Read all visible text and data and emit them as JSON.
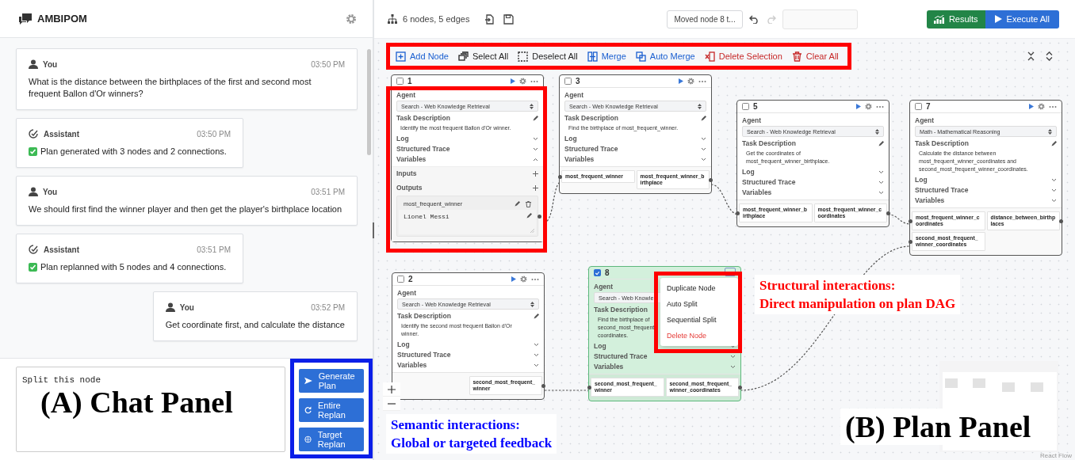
{
  "chat_panel": {
    "title": "AMBIPOM",
    "messages": [
      {
        "kind": "user",
        "sender": "You",
        "time": "03:50 PM",
        "text": "What is the distance between the birthplaces of the first and second most frequent Ballon d'Or winners?"
      },
      {
        "kind": "assistant",
        "sender": "Assistant",
        "time": "03:50 PM",
        "text": "Plan generated with 3 nodes and 2 connections."
      },
      {
        "kind": "user",
        "sender": "You",
        "time": "03:51 PM",
        "text": "We should first find the winner player and then get the player's birthplace location"
      },
      {
        "kind": "assistant",
        "sender": "Assistant",
        "time": "03:51 PM",
        "text": "Plan replanned with 5 nodes and 4 connections."
      },
      {
        "kind": "user",
        "sender": "You",
        "time": "03:52 PM",
        "text": "Get coordinate first, and calculate the distance"
      }
    ],
    "input": {
      "value": "Split this node"
    },
    "buttons": [
      {
        "kind": "send",
        "label": "Generate Plan"
      },
      {
        "kind": "replan",
        "label": "Entire Replan"
      },
      {
        "kind": "target",
        "label": "Target Replan"
      }
    ],
    "annotations": [
      {
        "kind": "panel_label",
        "lines": [
          "(A) Chat Panel"
        ],
        "color": "#000000"
      }
    ]
  },
  "plan_panel": {
    "summary": "6 nodes, 5 edges",
    "history": "Moved node 8 t...",
    "undo": {
      "disabled": false
    },
    "redo": {
      "disabled": true
    },
    "results": "Results",
    "execute": "Execute All",
    "toolbar": [
      {
        "kind": "add",
        "label": "Add Node",
        "color": "#1a5fd0"
      },
      {
        "kind": "select",
        "label": "Select All",
        "color": "#222222"
      },
      {
        "kind": "deselect",
        "label": "Deselect All",
        "color": "#222222"
      },
      {
        "kind": "merge",
        "label": "Merge",
        "color": "#1a5fd0"
      },
      {
        "kind": "auto_merge",
        "label": "Auto Merge",
        "color": "#1a5fd0"
      },
      {
        "kind": "delete",
        "label": "Delete Selection",
        "color": "#c62828"
      },
      {
        "kind": "clear",
        "label": "Clear All",
        "color": "#c62828"
      }
    ],
    "nodes": [
      {
        "id": "1",
        "checked": false,
        "selected": false,
        "menu_open": false,
        "agent_label": "Agent",
        "agent": "Search - Web Knowledge Retrieval",
        "task_label": "Task Description",
        "task_lines": [
          "Identify the most frequent Ballon d'Or winner."
        ],
        "sections": [
          {
            "label": "Log",
            "expanded": false
          },
          {
            "label": "Structured Trace",
            "expanded": false
          },
          {
            "label": "Variables",
            "expanded": true
          }
        ],
        "variables": {
          "inputs_label": "Inputs",
          "outputs_label": "Outputs",
          "outputs": [
            {
              "name": "most_frequent_winner",
              "value": "Lionel Messi"
            }
          ]
        }
      },
      {
        "id": "3",
        "checked": false,
        "selected": false,
        "menu_open": false,
        "agent_label": "Agent",
        "agent": "Search - Web Knowledge Retrieval",
        "task_label": "Task Description",
        "task_lines": [
          "Find the birthplace of most_frequent_winner."
        ],
        "sections": [
          {
            "label": "Log",
            "expanded": false
          },
          {
            "label": "Structured Trace",
            "expanded": false
          },
          {
            "label": "Variables",
            "expanded": false
          }
        ],
        "ports": [
          {
            "name": "most_frequent_winner",
            "kind": "input"
          },
          {
            "name": "most_frequent_winner_birthplace",
            "kind": "output"
          }
        ]
      },
      {
        "id": "5",
        "checked": false,
        "selected": false,
        "menu_open": false,
        "agent_label": "Agent",
        "agent": "Search - Web Knowledge Retrieval",
        "task_label": "Task Description",
        "task_lines": [
          "Get the coordinates of",
          "most_frequent_winner_birthplace."
        ],
        "sections": [
          {
            "label": "Log",
            "expanded": false
          },
          {
            "label": "Structured Trace",
            "expanded": false
          },
          {
            "label": "Variables",
            "expanded": false
          }
        ],
        "ports": [
          {
            "name": "most_frequent_winner_birthplace",
            "kind": "input"
          },
          {
            "name": "most_frequent_winner_coordinates",
            "kind": "output"
          }
        ]
      },
      {
        "id": "7",
        "checked": false,
        "selected": false,
        "menu_open": false,
        "agent_label": "Agent",
        "agent": "Math - Mathematical Reasoning",
        "task_label": "Task Description",
        "task_lines": [
          "Calculate the distance between",
          "most_frequent_winner_coordinates and",
          "second_most_frequent_winner_coordinates."
        ],
        "sections": [
          {
            "label": "Log",
            "expanded": false
          },
          {
            "label": "Structured Trace",
            "expanded": false
          },
          {
            "label": "Variables",
            "expanded": false
          }
        ],
        "ports": [
          {
            "name": "most_frequent_winner_coordinates",
            "kind": "input"
          },
          {
            "name": "distance_between_birthplaces",
            "kind": "output"
          },
          {
            "name": "second_most_frequent_winner_coordinates",
            "kind": "input"
          }
        ]
      },
      {
        "id": "2",
        "checked": false,
        "selected": false,
        "menu_open": false,
        "agent_label": "Agent",
        "agent": "Search - Web Knowledge Retrieval",
        "task_label": "Task Description",
        "task_lines": [
          "Identify the second most frequent Ballon d'Or",
          "winner."
        ],
        "sections": [
          {
            "label": "Log",
            "expanded": false
          },
          {
            "label": "Structured Trace",
            "expanded": false
          },
          {
            "label": "Variables",
            "expanded": false
          }
        ],
        "ports": [
          {
            "name": "second_most_frequent_winner",
            "kind": "output"
          }
        ]
      },
      {
        "id": "8",
        "checked": true,
        "selected": true,
        "menu_open": true,
        "agent_label": "Agent",
        "agent": "Search - Web Knowle",
        "task_label": "Task Description",
        "task_lines": [
          "Find the birthplace of",
          "second_most_frequent",
          "coordinates."
        ],
        "sections": [
          {
            "label": "Log",
            "expanded": false
          },
          {
            "label": "Structured Trace",
            "expanded": false
          },
          {
            "label": "Variables",
            "expanded": false
          }
        ],
        "ports": [
          {
            "name": "second_most_frequent_winner",
            "kind": "input"
          },
          {
            "name": "second_most_frequent_winner_coordinates",
            "kind": "output"
          }
        ]
      }
    ],
    "context_menu": [
      {
        "label": "Duplicate Node",
        "danger": false
      },
      {
        "label": "Auto Split",
        "danger": false
      },
      {
        "label": "Sequential Split",
        "danger": false
      },
      {
        "label": "Delete Node",
        "danger": true
      }
    ],
    "attribution": "React Flow",
    "annotations": [
      {
        "kind": "callout",
        "lines": [
          "Structural interactions:",
          "Direct manipulation on plan DAG"
        ],
        "color": "#ff0000"
      },
      {
        "kind": "callout",
        "lines": [
          "Semantic interactions:",
          "Global or targeted feedback"
        ],
        "color": "#0000ff"
      },
      {
        "kind": "panel_label",
        "lines": [
          "(B) Plan Panel"
        ],
        "color": "#000000"
      }
    ]
  }
}
